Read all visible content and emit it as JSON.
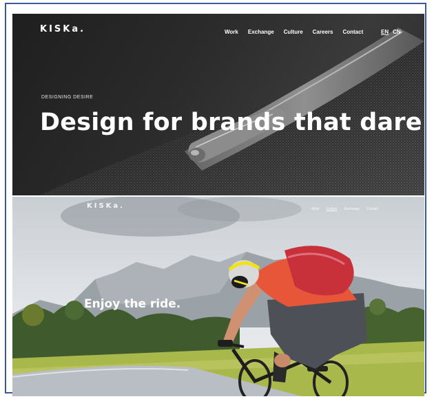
{
  "panel_1": {
    "logo": "KISKa.",
    "nav": [
      "Work",
      "Exchange",
      "Culture",
      "Careers",
      "Contact"
    ],
    "languages": [
      "EN",
      "CN"
    ],
    "active_language": "EN",
    "eyebrow": "DESIGNING DESIRE",
    "headline": "Design for brands that dare."
  },
  "panel_2": {
    "logo": "KISKa.",
    "nav": [
      "Work",
      "Culture",
      "Exchange",
      "Contact"
    ],
    "active_nav": "Culture",
    "headline": "Enjoy the ride."
  },
  "colors": {
    "frame_border": "#3a5a9a",
    "dark_hero": "#2a2a2a",
    "jersey": "#e8563a",
    "backpack": "#c8303a"
  },
  "icons": [
    "fabric-zipper-image",
    "cyclist-landscape-image"
  ]
}
